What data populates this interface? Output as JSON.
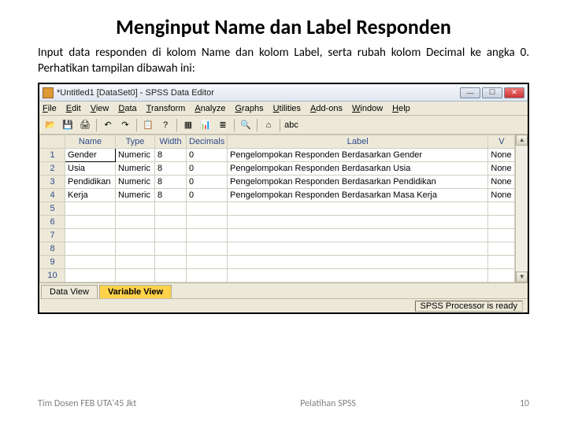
{
  "slide": {
    "title": "Menginput Name dan Label Responden",
    "desc": "Input data responden di kolom Name dan kolom Label, serta rubah kolom Decimal ke angka 0. Perhatikan tampilan dibawah ini:"
  },
  "window": {
    "title": "*Untitled1 [DataSet0] - SPSS Data Editor"
  },
  "menu": [
    "File",
    "Edit",
    "View",
    "Data",
    "Transform",
    "Analyze",
    "Graphs",
    "Utilities",
    "Add-ons",
    "Window",
    "Help"
  ],
  "columns": {
    "rownum": "",
    "name": "Name",
    "type": "Type",
    "width": "Width",
    "decimals": "Decimals",
    "label": "Label",
    "v": "V"
  },
  "rows": [
    {
      "n": "1",
      "name": "Gender",
      "type": "Numeric",
      "width": "8",
      "dec": "0",
      "label": "Pengelompokan Responden Berdasarkan Gender",
      "v": "None"
    },
    {
      "n": "2",
      "name": "Usia",
      "type": "Numeric",
      "width": "8",
      "dec": "0",
      "label": "Pengelompokan Responden Berdasarkan Usia",
      "v": "None"
    },
    {
      "n": "3",
      "name": "Pendidikan",
      "type": "Numeric",
      "width": "8",
      "dec": "0",
      "label": "Pengelompokan Responden Berdasarkan Pendidikan",
      "v": "None"
    },
    {
      "n": "4",
      "name": "Kerja",
      "type": "Numeric",
      "width": "8",
      "dec": "0",
      "label": "Pengelompokan Responden Berdasarkan Masa Kerja",
      "v": "None"
    },
    {
      "n": "5",
      "name": "",
      "type": "",
      "width": "",
      "dec": "",
      "label": "",
      "v": ""
    },
    {
      "n": "6",
      "name": "",
      "type": "",
      "width": "",
      "dec": "",
      "label": "",
      "v": ""
    },
    {
      "n": "7",
      "name": "",
      "type": "",
      "width": "",
      "dec": "",
      "label": "",
      "v": ""
    },
    {
      "n": "8",
      "name": "",
      "type": "",
      "width": "",
      "dec": "",
      "label": "",
      "v": ""
    },
    {
      "n": "9",
      "name": "",
      "type": "",
      "width": "",
      "dec": "",
      "label": "",
      "v": ""
    },
    {
      "n": "10",
      "name": "",
      "type": "",
      "width": "",
      "dec": "",
      "label": "",
      "v": ""
    }
  ],
  "tabs": {
    "data": "Data View",
    "variable": "Variable View"
  },
  "status": "SPSS Processor is ready",
  "footer": {
    "left": "Tim Dosen FEB UTA'45 Jkt",
    "center": "Pelatihan SPSS",
    "right": "10"
  },
  "toolbar_icons": [
    "📂",
    "💾",
    "🖨",
    "",
    "↶",
    "↷",
    "",
    "📋",
    "?",
    "",
    "▦",
    "📊",
    "≣",
    "",
    "🔍",
    "",
    "⌂",
    "",
    "abc"
  ]
}
